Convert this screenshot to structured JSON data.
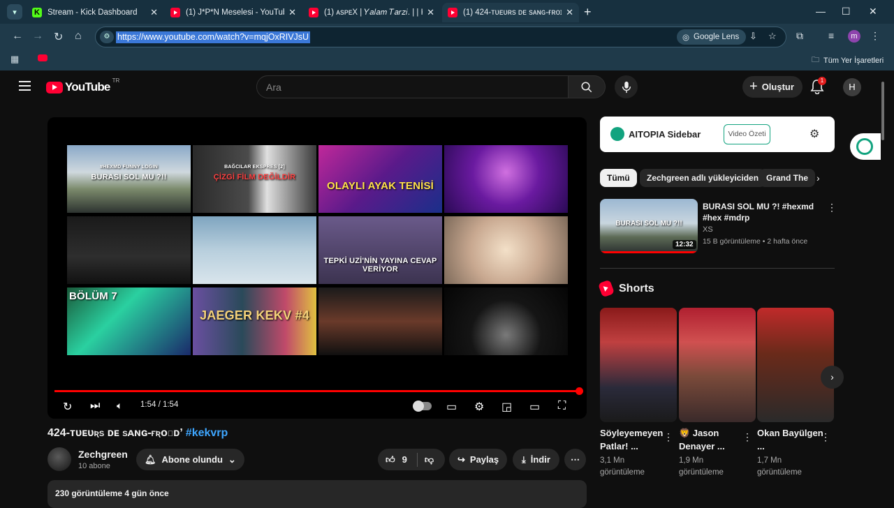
{
  "browser": {
    "tabs": [
      {
        "title": "Stream - Kick Dashboard",
        "favicon": "kick-icon",
        "active": false
      },
      {
        "title": "(1) J*P*N Meselesi - YouTube",
        "favicon": "youtube-icon",
        "active": false
      },
      {
        "title": "(1) ᴀsᴘᴇX | 𝑌𝑎𝑙𝑎𝑚 𝑇𝑎𝑟𝑧𝑖. | | Kek",
        "favicon": "youtube-icon",
        "active": false
      },
      {
        "title": "(1) 424-ᴛᴜᴇᴜʀs ᴅᴇ sᴀɴɢ-ғʀᴏɪᴅ’",
        "favicon": "youtube-icon",
        "active": true
      }
    ],
    "url": "https://www.youtube.com/watch?v=mqjOxRIVJsU",
    "lens_label": "Google Lens",
    "bookmarks_all": "Tüm Yer İşaretleri",
    "profile_initial": "m"
  },
  "youtube": {
    "country": "TR",
    "logo_text": "YouTube",
    "search_placeholder": "Ara",
    "create_label": "Oluştur",
    "notification_count": "1",
    "avatar_initial": "H"
  },
  "player": {
    "time": "1:54 / 1:54",
    "progress": 1.0,
    "thumbnails": [
      {
        "caption": "BURASI SOL MU ?!!",
        "sub": "#HEXMD FUNNY LOGIN",
        "bg": "linear-gradient(180deg,#8aa9c8 0%,#cfd8de 40%,#7b8a6c 65%,#2d3330 100%)"
      },
      {
        "caption": "ÇİZGİ FİLM DEĞİLDİR",
        "sub": "BAĞCILAR EKSPRES [2]",
        "bg": "linear-gradient(90deg,#2a2a2a 0%,#4b4b4b 45%,#e0e0e0 60%,#3a3a3a 100%)"
      },
      {
        "caption": "OLAYLI AYAK TENİSİ",
        "sub": "",
        "bg": "linear-gradient(135deg,#c0289a 0%,#5a1a8a 50%,#1a2f8a 100%)"
      },
      {
        "caption": "",
        "sub": "",
        "bg": "radial-gradient(circle at 50% 40%,#d070e0 0%,#6a1aa0 45%,#2a0a55 100%)"
      },
      {
        "caption": "",
        "sub": "",
        "bg": "linear-gradient(180deg,#1a1a1a 0%,#2e2e2e 60%,#111 100%)"
      },
      {
        "caption": "",
        "sub": "",
        "bg": "linear-gradient(180deg,#7fa5c0 0%,#b8cfdd 50%,#d9e5ec 100%)"
      },
      {
        "caption": "TEPKİ UZİ'NİN YAYINA CEVAP VERİYOR",
        "sub": "",
        "bg": "linear-gradient(180deg,#6a5a8a 0%,#3c3350 100%)"
      },
      {
        "caption": "",
        "sub": "",
        "bg": "radial-gradient(circle at 50% 50%,#f3e0c8 0%,#c8a890 50%,#7d6a5a 100%)"
      },
      {
        "caption": "BÖLÜM 7",
        "sub": "",
        "bg": "linear-gradient(135deg,#1a5a3a 0%,#2ad0a0 40%,#1a2a6a 100%)"
      },
      {
        "caption": "JAEGER   KEKV #4",
        "sub": "",
        "bg": "linear-gradient(90deg,#6a4fa0 0%,#2a4a5a 40%,#c04a6a 75%,#e0c040 100%)"
      },
      {
        "caption": "",
        "sub": "",
        "bg": "linear-gradient(180deg,#1a1a1a 0%,#6a3a2a 50%,#101010 100%)"
      },
      {
        "caption": "",
        "sub": "",
        "bg": "radial-gradient(circle at 50% 70%,#7a7a7a 0%,#151515 45%,#050505 100%)"
      }
    ]
  },
  "video": {
    "title_sc": "424-ᴛᴜᴇᴜʀs ᴅᴇ sᴀɴɢ-ғʀᴏɪᴅ’",
    "hashtag": "#kekvrp",
    "channel": "Zechgreen",
    "subscribers": "10 abone",
    "subscribe_label": "Abone olundu",
    "likes": "9",
    "share_label": "Paylaş",
    "download_label": "İndir",
    "meta": "230 görüntüleme  4 gün önce"
  },
  "aitopia": {
    "name": "AITOPIA Sidebar",
    "button": "Video Özeti"
  },
  "chips": [
    "Tümü",
    "Zechgreen adlı yükleyiciden",
    "Grand The"
  ],
  "recommendation": {
    "title": "BURASI SOL MU ?!  #hexmd #hex #mdrp",
    "thumb_caption": "BURASI SOL MU ?!!",
    "channel": "XS",
    "meta": "15 B görüntüleme • 2 hafta önce",
    "duration": "12:32"
  },
  "shorts": {
    "heading": "Shorts",
    "items": [
      {
        "title": "Söyleyemeyen Patlar! ...",
        "views": "3,1 Mn görüntüleme",
        "bg": "linear-gradient(180deg,#8a1a1a 0%,#c04040 30%,#2a2a3a 70%,#1a1a1a 100%)"
      },
      {
        "title": "🦁 Jason Denayer ...",
        "views": "1,9 Mn görüntüleme",
        "bg": "linear-gradient(180deg,#b02030 0%,#d05050 30%,#7a4a3a 60%,#3a2a2a 100%)"
      },
      {
        "title": "Okan Bayülgen ...",
        "views": "1,7 Mn görüntüleme",
        "bg": "linear-gradient(180deg,#c02a2a 0%,#6a2a1a 40%,#2a2a2a 100%)"
      }
    ]
  }
}
